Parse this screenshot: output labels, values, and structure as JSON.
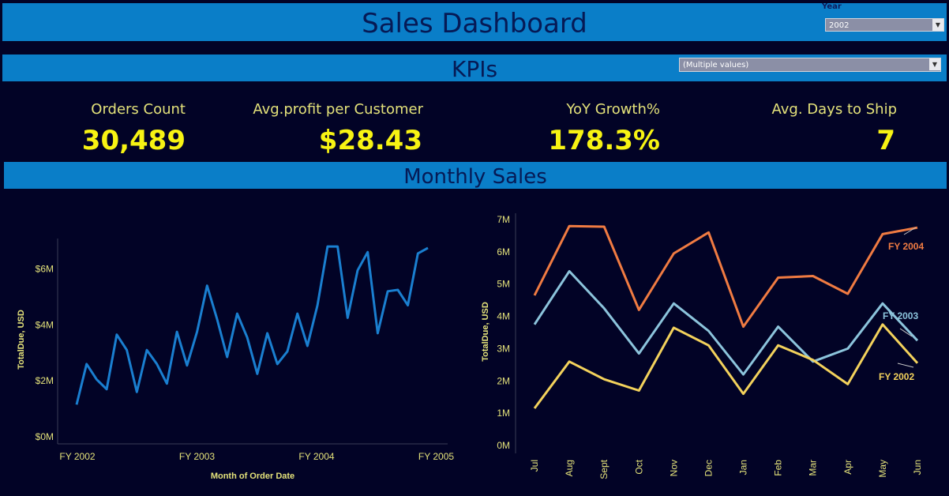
{
  "header": {
    "title": "Sales Dashboard"
  },
  "filters": {
    "year_label": "Year",
    "year_value": "2002",
    "segment_value": "(Multiple values)"
  },
  "kpi_section": {
    "title": "KPIs"
  },
  "kpis": [
    {
      "label": "Orders Count",
      "value": "30,489"
    },
    {
      "label": "Avg.profit per Customer",
      "value": "$28.43"
    },
    {
      "label": "YoY Growth%",
      "value": "178.3%"
    },
    {
      "label": "Avg. Days to Ship",
      "value": "7"
    }
  ],
  "monthly_section": {
    "title": "Monthly Sales"
  },
  "colors": {
    "background": "#020326",
    "band": "#0a7ec8",
    "kpi_value": "#f7f313",
    "axis_text": "#e4e27a",
    "line_total": "#1a7fd0",
    "fy2004": "#f07b42",
    "fy2003": "#8cc4dc",
    "fy2002": "#f3d25c"
  },
  "chart_data": [
    {
      "type": "line",
      "xlabel": "Month of Order Date",
      "ylabel": "TotalDue, USD",
      "x_ticks": [
        "FY 2002",
        "FY 2003",
        "FY 2004",
        "FY 2005"
      ],
      "y_ticks": [
        "$0M",
        "$2M",
        "$4M",
        "$6M"
      ],
      "ylim": [
        0,
        7000000
      ],
      "series": [
        {
          "values": [
            1.15,
            2.6,
            2.05,
            1.7,
            3.65,
            3.1,
            1.6,
            3.1,
            2.6,
            1.9,
            3.75,
            2.55,
            3.75,
            5.4,
            4.2,
            2.85,
            4.4,
            3.55,
            2.25,
            3.7,
            2.6,
            3.05,
            4.4,
            3.25,
            4.7,
            6.8,
            6.8,
            4.25,
            5.95,
            6.6,
            3.7,
            5.2,
            5.25,
            4.7,
            6.55,
            6.75
          ]
        }
      ]
    },
    {
      "type": "line",
      "ylabel": "TotalDue, USD",
      "categories": [
        "Jul",
        "Aug",
        "Sept",
        "Oct",
        "Nov",
        "Dec",
        "Jan",
        "Feb",
        "Mar",
        "Apr",
        "May",
        "Jun"
      ],
      "y_ticks": [
        "0M",
        "1M",
        "2M",
        "3M",
        "4M",
        "5M",
        "6M",
        "7M"
      ],
      "ylim": [
        0,
        7
      ],
      "series": [
        {
          "name": "FY 2004",
          "values": [
            4.65,
            6.8,
            6.78,
            4.2,
            5.95,
            6.6,
            3.68,
            5.2,
            5.25,
            4.7,
            6.55,
            6.75
          ]
        },
        {
          "name": "FY 2003",
          "values": [
            3.75,
            5.4,
            4.25,
            2.85,
            4.4,
            3.55,
            2.2,
            3.68,
            2.6,
            3.0,
            4.4,
            3.25
          ]
        },
        {
          "name": "FY 2002",
          "values": [
            1.15,
            2.6,
            2.05,
            1.7,
            3.65,
            3.1,
            1.6,
            3.1,
            2.65,
            1.9,
            3.75,
            2.55
          ]
        }
      ]
    }
  ]
}
